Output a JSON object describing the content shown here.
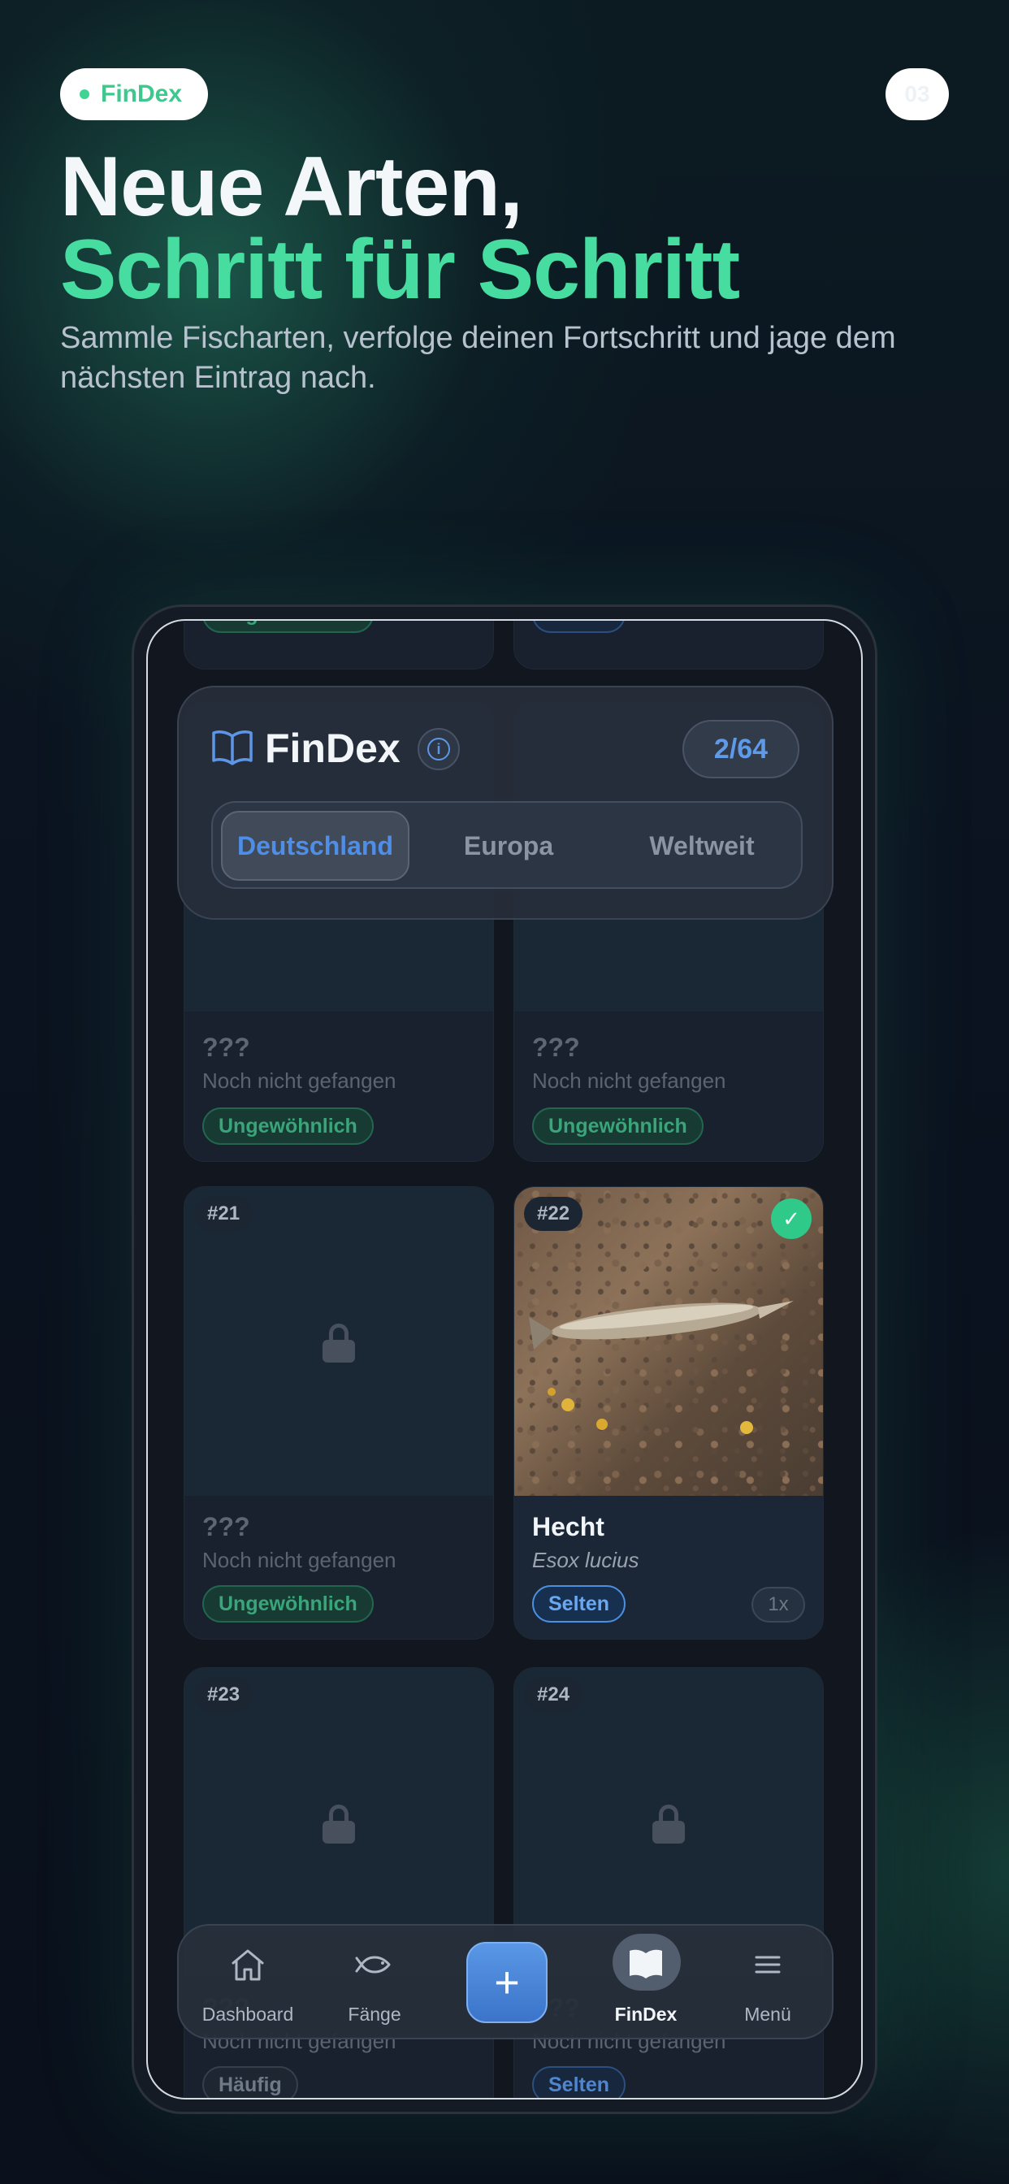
{
  "promo": {
    "pill_label": "FinDex",
    "step": "03",
    "headline_line1": "Neue Arten,",
    "headline_line2": "Schritt für Schritt",
    "subtitle": "Sammle Fischarten, verfolge deinen Fortschritt und jage dem nächsten Eintrag nach."
  },
  "app": {
    "title": "FinDex",
    "progress": "2/64",
    "info_glyph": "i",
    "icons": {
      "title": "book-icon",
      "info": "info-icon"
    },
    "tabs": [
      {
        "label": "Deutschland",
        "active": true
      },
      {
        "label": "Europa",
        "active": false
      },
      {
        "label": "Weltweit",
        "active": false
      }
    ]
  },
  "grid": {
    "top_partial": [
      {
        "rarity": "Ungewöhnlich"
      },
      {
        "rarity": "Selten"
      }
    ],
    "row_under_header": [
      {
        "name": "???",
        "status": "Noch nicht gefangen",
        "rarity": "Ungewöhnlich"
      },
      {
        "name": "???",
        "status": "Noch nicht gefangen",
        "rarity": "Ungewöhnlich"
      }
    ],
    "cards": [
      {
        "number": "#21",
        "name": "???",
        "status": "Noch nicht gefangen",
        "rarity": "Ungewöhnlich",
        "caught": false
      },
      {
        "number": "#22",
        "name": "Hecht",
        "latin": "Esox lucius",
        "rarity": "Selten",
        "count": "1x",
        "caught": true,
        "check": "✓"
      },
      {
        "number": "#23",
        "name": "???",
        "status": "Noch nicht gefangen",
        "rarity": "Häufig",
        "caught": false
      },
      {
        "number": "#24",
        "name": "???",
        "status": "Noch nicht gefangen",
        "rarity": "Selten",
        "caught": false
      }
    ]
  },
  "nav": {
    "items": [
      {
        "label": "Dashboard",
        "icon": "home-icon"
      },
      {
        "label": "Fänge",
        "icon": "fish-icon"
      },
      {
        "label": "+",
        "icon": "plus-icon"
      },
      {
        "label": "FinDex",
        "icon": "book-open-icon",
        "active": true
      },
      {
        "label": "Menü",
        "icon": "menu-icon"
      }
    ]
  },
  "colors": {
    "accent_green": "#47dca0",
    "accent_blue": "#4f8ee6",
    "background": "#0b1320"
  }
}
